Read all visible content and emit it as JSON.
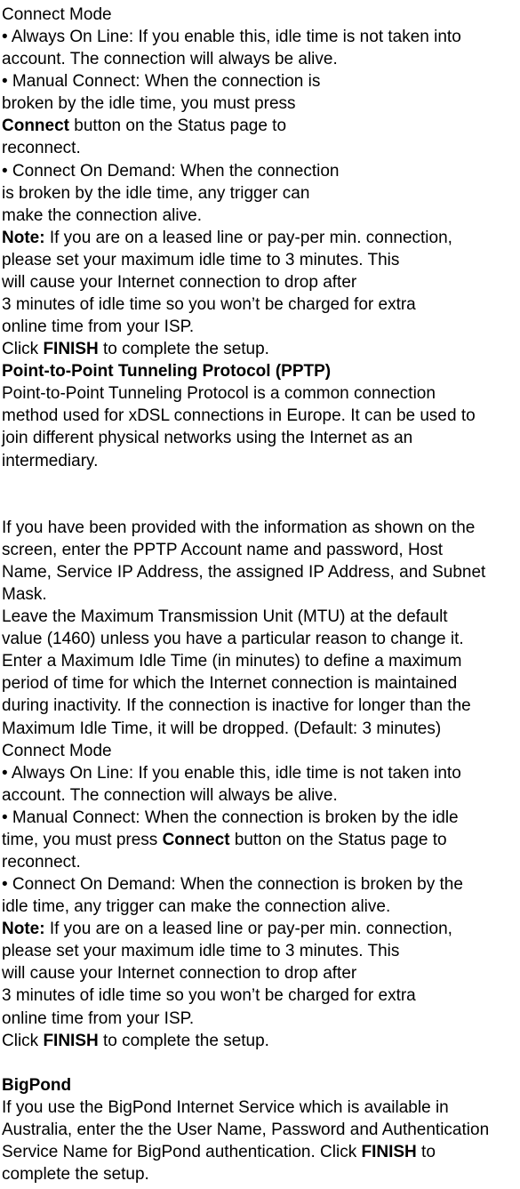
{
  "s1_h": "Connect Mode",
  "s1_b1a": "• Always On Line: If you enable this, idle time is not taken into",
  "s1_b1b": "account. The connection will always be alive.",
  "s1_b2a": "• Manual Connect: When the connection is",
  "s1_b2b": "broken by the idle time, you must press",
  "s1_b2c_bold": "Connect",
  "s1_b2c_rest": " button on the Status page to",
  "s1_b2d": "reconnect.",
  "s1_b3a": "• Connect On Demand: When the connection",
  "s1_b3b": "is broken by the idle time, any trigger can",
  "s1_b3c": "make the connection alive.",
  "s1_note_bold": "Note:",
  "s1_note_rest": " If you are on a leased line or pay-per min. connection,",
  "s1_note_l2": "please set your maximum idle time to 3 minutes. This",
  "s1_note_l3": "will cause your Internet connection to drop after",
  "s1_note_l4": "3 minutes of idle time so you won’t be charged for extra",
  "s1_note_l5": "online time from your ISP.",
  "s1_finish_pre": "Click ",
  "s1_finish_bold": "FINISH",
  "s1_finish_post": " to complete the setup.",
  "pptp_h": "Point-to-Point Tunneling Protocol (PPTP)",
  "pptp_p1a": "Point-to-Point Tunneling Protocol is a common connection",
  "pptp_p1b": "method used for xDSL connections in Europe. It can be used to",
  "pptp_p1c": "join different physical networks using the Internet as an",
  "pptp_p1d": "intermediary.",
  "pptp_p2a": "If you have been provided with the information as shown on the",
  "pptp_p2b": "screen, enter the PPTP Account name and password, Host",
  "pptp_p2c": "Name, Service IP Address, the assigned IP Address, and Subnet",
  "pptp_p2d": "Mask.",
  "pptp_p3a": "Leave the Maximum Transmission Unit (MTU) at the default",
  "pptp_p3b": "value (1460) unless you have a particular reason to change it.",
  "pptp_p4a": "Enter a Maximum Idle Time (in minutes) to define a maximum",
  "pptp_p4b": "period of time for which the Internet connection is maintained",
  "pptp_p4c": "during inactivity. If the connection is inactive for longer than the",
  "pptp_p4d": "Maximum Idle Time, it will be dropped. (Default: 3 minutes)",
  "s2_h": "Connect Mode",
  "s2_b1a": "• Always On Line: If you enable this, idle time is not taken into",
  "s2_b1b": "account. The connection will always be alive.",
  "s2_b2a": "• Manual Connect: When the connection is broken by the idle",
  "s2_b2b_pre": "time, you must press ",
  "s2_b2b_bold": "Connect",
  "s2_b2b_post": " button on the Status page to",
  "s2_b2c": "reconnect.",
  "s2_b3a": "• Connect On Demand: When the connection is broken by the",
  "s2_b3b": "idle time, any trigger can make the connection alive.",
  "s2_note_bold": "Note:",
  "s2_note_rest": " If you are on a leased line or pay-per min. connection,",
  "s2_note_l2": "please set your maximum idle time to 3 minutes. This",
  "s2_note_l3": "will cause your Internet connection to drop after",
  "s2_note_l4": "3 minutes of idle time so you won’t be charged for extra",
  "s2_note_l5": "online time from your ISP.",
  "s2_finish_pre": "Click ",
  "s2_finish_bold": "FINISH",
  "s2_finish_post": " to complete the setup.",
  "bp_h": "BigPond",
  "bp_l1": "If you use the BigPond Internet Service which is available in",
  "bp_l2": "Australia, enter the the User Name, Password and Authentication",
  "bp_l3_pre": "Service Name for BigPond authentication. Click ",
  "bp_l3_bold": "FINISH",
  "bp_l3_post": " to",
  "bp_l4": "complete the setup."
}
